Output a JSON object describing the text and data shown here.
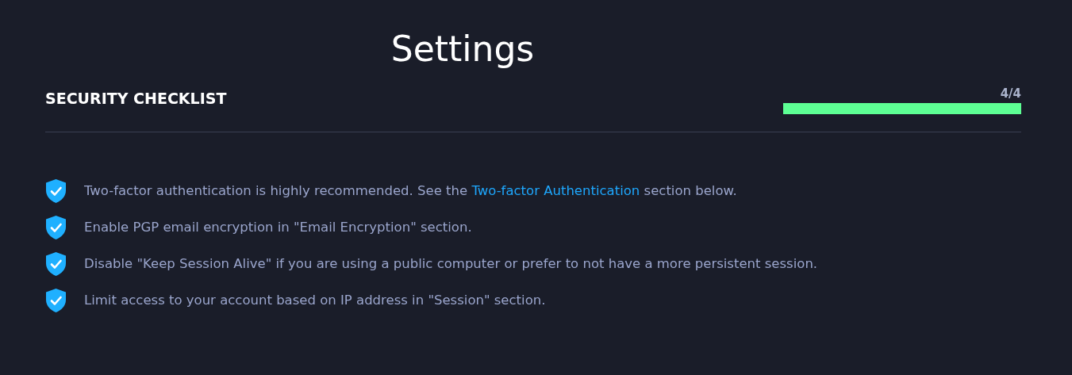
{
  "page": {
    "title": "Settings"
  },
  "security_checklist": {
    "heading": "SECURITY CHECKLIST",
    "progress_text": "4/4",
    "level": 1.0,
    "items": [
      {
        "done": true,
        "text": "Two-factor authentication is highly recommended. See the ",
        "link": "Two-factor Authentication",
        "text_after": " section below."
      },
      {
        "done": true,
        "text": "Enable PGP email encryption in \"Email Encryption\" section."
      },
      {
        "done": true,
        "text": "Disable \"Keep Session Alive\" if you are using a public computer or prefer to not have a more persistent session."
      },
      {
        "done": true,
        "text": "Limit access to your account based on IP address in \"Session\" section."
      }
    ]
  }
}
